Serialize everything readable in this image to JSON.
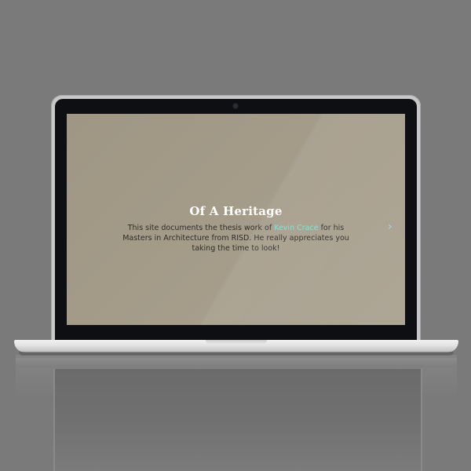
{
  "site": {
    "title": "Of A Heritage",
    "description_before": "This site documents the thesis work of ",
    "author_link": "Kevin Crace",
    "description_after": " for his Masters in Architecture from RISD. He really appreciates you taking the time to look!",
    "next_icon": "chevron-right-icon"
  },
  "colors": {
    "background": "#7b7b7b",
    "screen": "#a59c8a",
    "title": "#ffffff",
    "body_text": "#2f2c28",
    "accent": "#7fe0d8"
  }
}
